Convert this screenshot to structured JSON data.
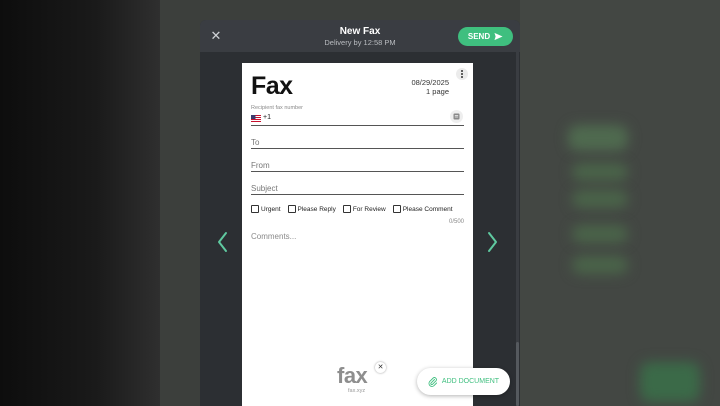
{
  "header": {
    "title": "New Fax",
    "subtitle": "Delivery by 12:58 PM",
    "send_label": "SEND"
  },
  "page": {
    "title": "Fax",
    "date": "08/29/2025",
    "pages": "1 page",
    "recipient_label": "Recipient fax number",
    "country_code": "+1",
    "to_placeholder": "To",
    "from_placeholder": "From",
    "subject_placeholder": "Subject",
    "checkboxes": [
      "Urgent",
      "Please Reply",
      "For Review",
      "Please Comment"
    ],
    "char_counter": "0/500",
    "comments_placeholder": "Comments..."
  },
  "logo": {
    "word": "fax",
    "sub": "fax.xyz"
  },
  "add_document_label": "ADD DOCUMENT",
  "colors": {
    "accent": "#3fbf7f",
    "nav_arrow": "#5fc9a0"
  },
  "icons": [
    "close-icon",
    "send-icon",
    "kebab-icon",
    "us-flag-icon",
    "contacts-icon",
    "chevron-left-icon",
    "chevron-right-icon",
    "paperclip-icon"
  ]
}
